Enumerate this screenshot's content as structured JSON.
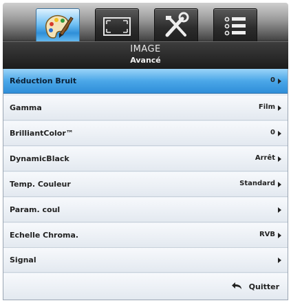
{
  "menu": {
    "title": "IMAGE",
    "subtitle": "Avancé"
  },
  "tabs": [
    {
      "icon": "palette-icon",
      "active": true
    },
    {
      "icon": "screen-expand-icon",
      "active": false
    },
    {
      "icon": "tools-icon",
      "active": false
    },
    {
      "icon": "list-icon",
      "active": false
    }
  ],
  "items": [
    {
      "label": "Réduction Bruit",
      "value": "0",
      "selected": true
    },
    {
      "label": "Gamma",
      "value": "Film",
      "selected": false
    },
    {
      "label": "BrilliantColor™",
      "value": "0",
      "selected": false
    },
    {
      "label": "DynamicBlack",
      "value": "Arrêt",
      "selected": false
    },
    {
      "label": "Temp. Couleur",
      "value": "Standard",
      "selected": false
    },
    {
      "label": "Param. coul",
      "value": "",
      "selected": false
    },
    {
      "label": "Echelle Chroma.",
      "value": "RVB",
      "selected": false
    },
    {
      "label": "Signal",
      "value": "",
      "selected": false
    }
  ],
  "footer": {
    "exit_label": "Quitter",
    "exit_icon": "return-arrow-icon"
  },
  "colors": {
    "selection": "#4ba7e8",
    "active_tab": "#6fbff3",
    "header": "#1b1b1b"
  }
}
